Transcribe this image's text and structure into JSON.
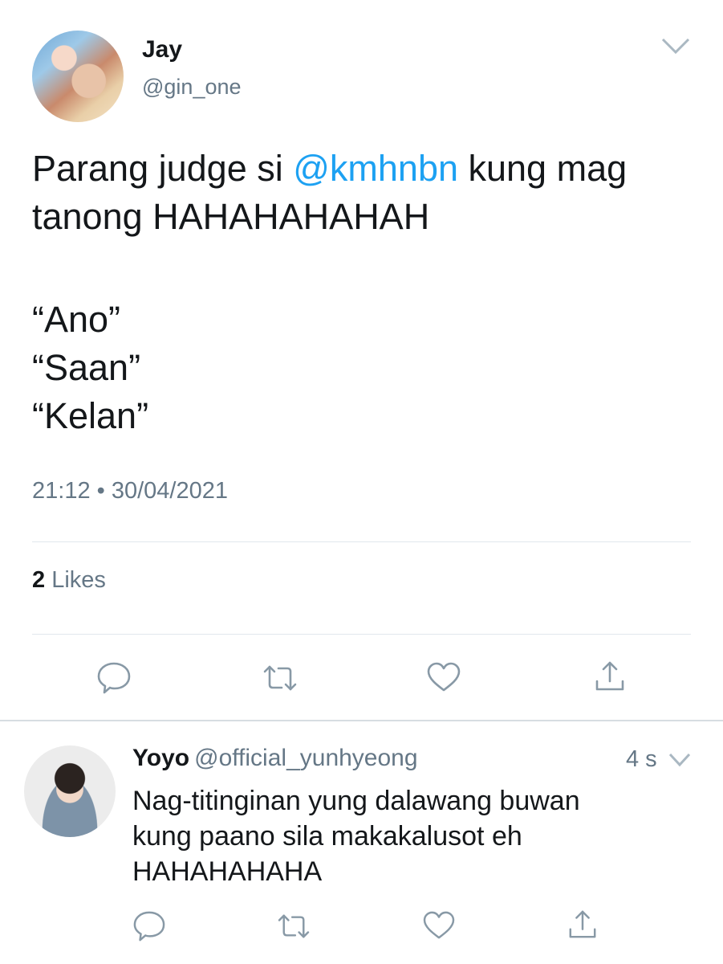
{
  "tweet": {
    "author_name": "Jay",
    "author_handle": "@gin_one",
    "text_before_mention": "Parang judge si ",
    "mention": "@kmhnbn",
    "text_after_mention": " kung mag tanong HAHAHAHAHAH",
    "quotes": [
      "“Ano”",
      "“Saan”",
      "“Kelan”"
    ],
    "timestamp": "21:12 • 30/04/2021",
    "likes_count": "2",
    "likes_label": " Likes",
    "actions": [
      "reply-icon",
      "retweet-icon",
      "like-icon",
      "share-icon"
    ]
  },
  "reply": {
    "author_name": "Yoyo",
    "author_handle": "@official_yunhyeong",
    "time": "4 s",
    "lines": [
      "Nag-titinginan yung dalawang buwan",
      "kung paano sila makakalusot eh",
      "HAHAHAHAHA"
    ],
    "actions": [
      "reply-icon",
      "retweet-icon",
      "like-icon",
      "share-icon"
    ]
  },
  "colors": {
    "text": "#14171a",
    "secondary": "#657786",
    "link": "#1da1f2",
    "icon": "#8899a6",
    "divider": "#e1e8ed"
  }
}
